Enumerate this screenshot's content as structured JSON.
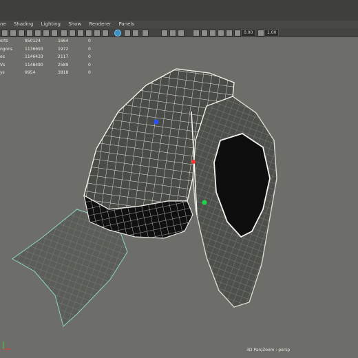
{
  "menu": [
    "ne",
    "Shading",
    "Lighting",
    "Show",
    "Renderer",
    "Panels"
  ],
  "toolbar": {
    "field_a": "0.00",
    "field_b": "1.00"
  },
  "hud_rows": [
    {
      "label": "erts",
      "v1": "850124",
      "v2": "1664",
      "v3": "0"
    },
    {
      "label": "ngons",
      "v1": "1136693",
      "v2": "1972",
      "v3": "0"
    },
    {
      "label": "es",
      "v1": "1146433",
      "v2": "2117",
      "v3": "0"
    },
    {
      "label": "Vs",
      "v1": "1148480",
      "v2": "2589",
      "v3": "0"
    },
    {
      "label": "ys",
      "v1": "9954",
      "v2": "3818",
      "v3": "0"
    }
  ],
  "camera_label": "3D Pan/Zoom : persp",
  "colors": {
    "viewport_bg": "#6d6d69",
    "active_icon": "#3b8ec2"
  }
}
